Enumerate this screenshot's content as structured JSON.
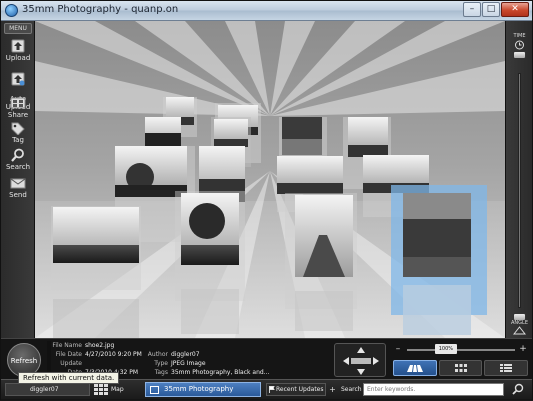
{
  "window": {
    "title": "35mm Photography - quanp.on",
    "minimize": "–",
    "maximize": "□",
    "close": "✕"
  },
  "sidebar": {
    "menu_label": "MENU",
    "items": [
      {
        "label": "Upload",
        "icon": "upload-icon"
      },
      {
        "label": "Auto\nUpload",
        "icon": "auto-upload-icon"
      },
      {
        "label": "Share",
        "icon": "share-icon"
      },
      {
        "label": "Tag",
        "icon": "tag-icon"
      },
      {
        "label": "Search",
        "icon": "search-icon"
      },
      {
        "label": "Send",
        "icon": "send-icon"
      }
    ]
  },
  "timebar": {
    "top_label": "TIME",
    "bottom_label": "ANGLE"
  },
  "details": {
    "file_name_label": "File Name",
    "file_name": "shoe2.jpg",
    "file_date_label": "File Date",
    "file_date": "4/27/2010 9:20 PM",
    "update_date_label": "Update Date",
    "update_date": "7/3/2010 4:32 PM",
    "author_label": "Author",
    "author": "diggler07",
    "type_label": "Type",
    "type": "JPEG Image",
    "tags_label": "Tags",
    "tags": "35mm Photography, Black and..."
  },
  "refresh_label": "Refresh",
  "tooltip": "Refresh with current data.",
  "zoom": {
    "percent": "100%",
    "minus": "–",
    "plus": "+",
    "fraction": 0.36
  },
  "statusbar": {
    "user": "diggler07",
    "map_label": "Map",
    "album": "35mm Photography",
    "recent": "Recent Updates",
    "plus": "+",
    "search_label": "Search",
    "search_placeholder": "Enter keywords."
  },
  "colors": {
    "selection": "#7fb7e8",
    "album_blue": "#2a5a9a"
  }
}
